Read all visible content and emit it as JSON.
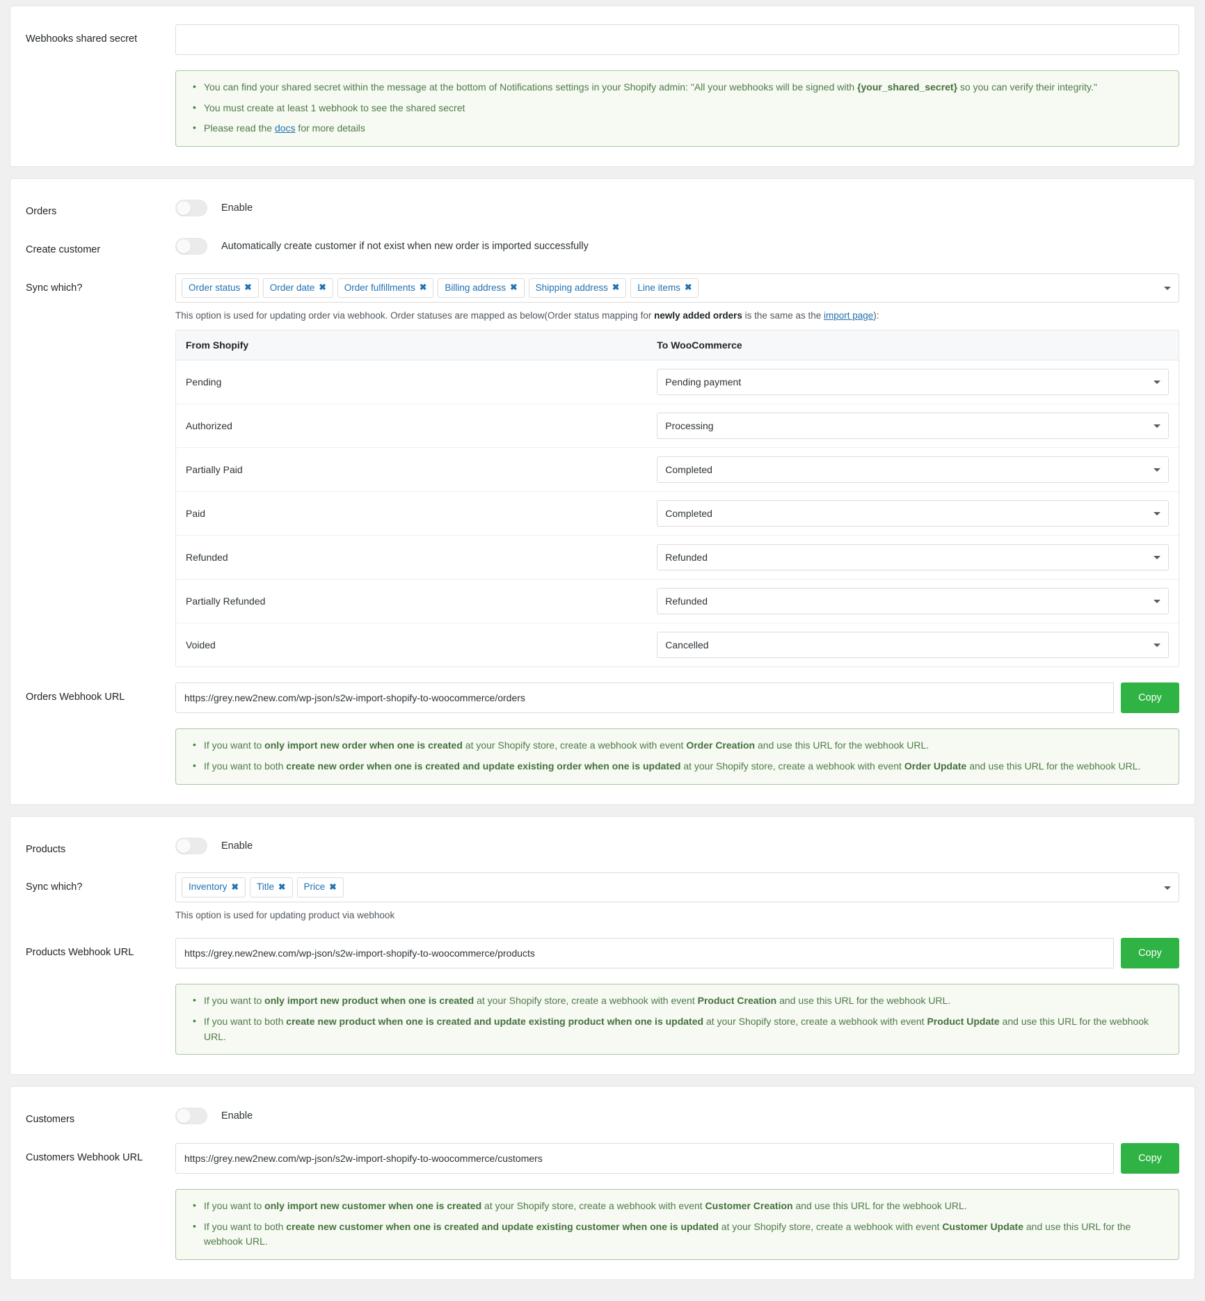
{
  "shared_secret": {
    "label": "Webhooks shared secret",
    "value": "",
    "placeholder": "",
    "notice": {
      "line1_a": "You can find your shared secret within the message at the bottom of Notifications settings in your Shopify admin: \"All your webhooks will be signed with ",
      "line1_b": "{your_shared_secret}",
      "line1_c": " so you can verify their integrity.\"",
      "line2": "You must create at least 1 webhook to see the shared secret",
      "line3_a": "Please read the ",
      "line3_link": "docs",
      "line3_b": " for more details"
    }
  },
  "orders": {
    "enable_label": "Orders",
    "enable_text": "Enable",
    "enable_on": false,
    "create_customer_label": "Create customer",
    "create_customer_text": "Automatically create customer if not exist when new order is imported successfully",
    "create_customer_on": false,
    "sync_label": "Sync which?",
    "sync_chips": [
      "Order status",
      "Order date",
      "Order fulfillments",
      "Billing address",
      "Shipping address",
      "Line items"
    ],
    "helper_a": "This option is used for updating order via webhook. Order statuses are mapped as below(Order status mapping for ",
    "helper_bold": "newly added orders",
    "helper_b": " is the same as the ",
    "helper_link": "import page",
    "helper_c": "):",
    "table": {
      "header_from": "From Shopify",
      "header_to": "To WooCommerce",
      "rows": [
        {
          "from": "Pending",
          "to": "Pending payment"
        },
        {
          "from": "Authorized",
          "to": "Processing"
        },
        {
          "from": "Partially Paid",
          "to": "Completed"
        },
        {
          "from": "Paid",
          "to": "Completed"
        },
        {
          "from": "Refunded",
          "to": "Refunded"
        },
        {
          "from": "Partially Refunded",
          "to": "Refunded"
        },
        {
          "from": "Voided",
          "to": "Cancelled"
        }
      ]
    },
    "url_label": "Orders Webhook URL",
    "url_value": "https://grey.new2new.com/wp-json/s2w-import-shopify-to-woocommerce/orders",
    "copy_label": "Copy",
    "notice": {
      "line1_a": "If you want to ",
      "line1_b": "only import new order when one is created",
      "line1_c": " at your Shopify store, create a webhook with event ",
      "line1_d": "Order Creation",
      "line1_e": " and use this URL for the webhook URL.",
      "line2_a": "If you want to both ",
      "line2_b": "create new order when one is created and update existing order when one is updated",
      "line2_c": " at your Shopify store, create a webhook with event ",
      "line2_d": "Order Update",
      "line2_e": " and use this URL for the webhook URL."
    }
  },
  "products": {
    "enable_label": "Products",
    "enable_text": "Enable",
    "enable_on": false,
    "sync_label": "Sync which?",
    "sync_chips": [
      "Inventory",
      "Title",
      "Price"
    ],
    "helper": "This option is used for updating product via webhook",
    "url_label": "Products Webhook URL",
    "url_value": "https://grey.new2new.com/wp-json/s2w-import-shopify-to-woocommerce/products",
    "copy_label": "Copy",
    "notice": {
      "line1_a": "If you want to ",
      "line1_b": "only import new product when one is created",
      "line1_c": " at your Shopify store, create a webhook with event ",
      "line1_d": "Product Creation",
      "line1_e": " and use this URL for the webhook URL.",
      "line2_a": "If you want to both ",
      "line2_b": "create new product when one is created and update existing product when one is updated",
      "line2_c": " at your Shopify store, create a webhook with event ",
      "line2_d": "Product Update",
      "line2_e": " and use this URL for the webhook URL."
    }
  },
  "customers": {
    "enable_label": "Customers",
    "enable_text": "Enable",
    "enable_on": false,
    "url_label": "Customers Webhook URL",
    "url_value": "https://grey.new2new.com/wp-json/s2w-import-shopify-to-woocommerce/customers",
    "copy_label": "Copy",
    "notice": {
      "line1_a": "If you want to ",
      "line1_b": "only import new customer when one is created",
      "line1_c": " at your Shopify store, create a webhook with event ",
      "line1_d": "Customer Creation",
      "line1_e": " and use this URL for the webhook URL.",
      "line2_a": "If you want to both ",
      "line2_b": "create new customer when one is created and update existing customer when one is updated",
      "line2_c": " at your Shopify store, create a webhook with event ",
      "line2_d": "Customer Update",
      "line2_e": " and use this URL for the webhook URL."
    }
  },
  "icons": {
    "chip_remove": "✖",
    "bullet": "•"
  }
}
